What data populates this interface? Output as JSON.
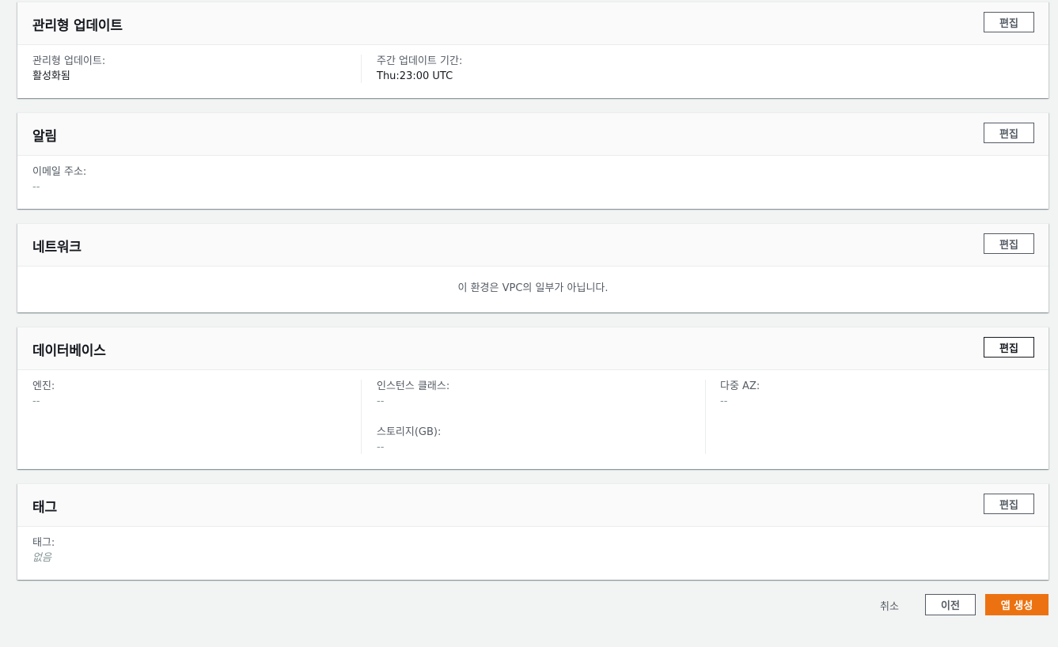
{
  "colors": {
    "page_bg": "#f2f3f3",
    "primary": "#ec7211",
    "border": "#545b64"
  },
  "edit_label": "편집",
  "managed_updates": {
    "title": "관리형 업데이트",
    "items": [
      {
        "label": "관리형 업데이트:",
        "value": "활성화됨"
      },
      {
        "label": "주간 업데이트 기간:",
        "value": "Thu:23:00 UTC"
      }
    ]
  },
  "notifications": {
    "title": "알림",
    "items": [
      {
        "label": "이메일 주소:",
        "value": "--"
      }
    ]
  },
  "network": {
    "title": "네트워크",
    "message": "이 환경은 VPC의 일부가 아닙니다."
  },
  "database": {
    "title": "데이터베이스",
    "engine": {
      "label": "엔진:",
      "value": "--"
    },
    "instance_class": {
      "label": "인스턴스 클래스:",
      "value": "--"
    },
    "storage": {
      "label": "스토리지(GB):",
      "value": "--"
    },
    "multi_az": {
      "label": "다중 AZ:",
      "value": "--"
    }
  },
  "tags": {
    "title": "태그",
    "items": [
      {
        "label": "태그:",
        "value": "없음"
      }
    ]
  },
  "footer": {
    "cancel_label": "취소",
    "previous_label": "이전",
    "create_label": "앱 생성"
  }
}
